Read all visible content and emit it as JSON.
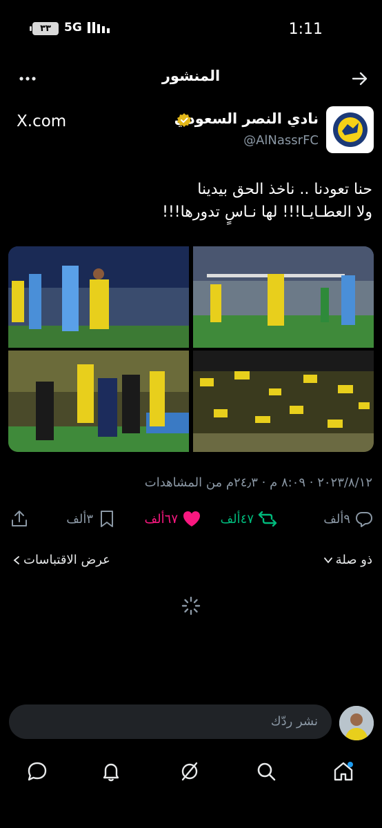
{
  "status_bar": {
    "time": "1:11",
    "network": "5G",
    "battery": "٣٣"
  },
  "header": {
    "title": "المنشور"
  },
  "author": {
    "name": "نادي النصر السعودي",
    "handle": "@AlNassrFC",
    "source": "X.com"
  },
  "post": {
    "line1": "حنا تعودنا .. ناخذ الحق بيدينا",
    "line2": "ولا العطـايـا!!! لها نـاسٍ تدورها!!!"
  },
  "meta": {
    "text": "٢٠٢٣/٨/١٢ · ٨:٠٩ م · ٢٤٫٣م من المشاهدات"
  },
  "actions": {
    "replies": "٩ألف",
    "retweets": "٤٧ألف",
    "likes": "٦٧ألف",
    "bookmarks": "٣ألف"
  },
  "filters": {
    "sort": "ذو صلة",
    "quotes": "عرض الاقتباسات"
  },
  "reply": {
    "placeholder": "نشر ردّك"
  },
  "colors": {
    "accent": "#1d9bf0",
    "retweet": "#00ba7c",
    "like": "#f91880",
    "muted": "#8b98a5"
  }
}
